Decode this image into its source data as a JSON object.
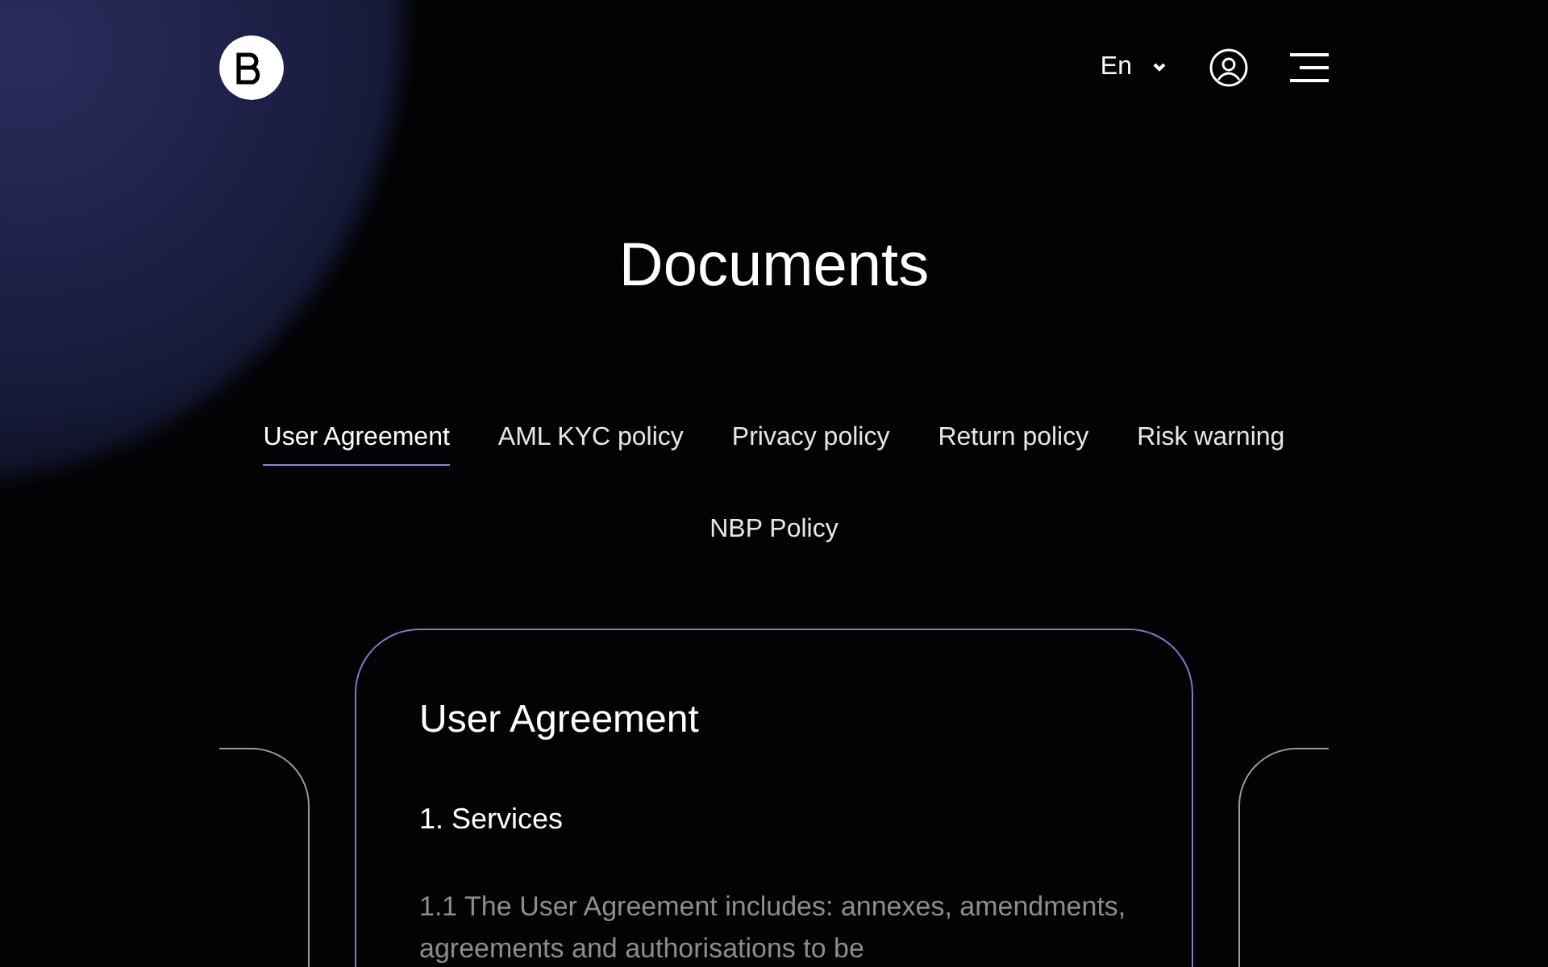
{
  "header": {
    "language": "En"
  },
  "title": "Documents",
  "tabs": [
    {
      "label": "User Agreement",
      "selected": true
    },
    {
      "label": "AML KYC policy",
      "selected": false
    },
    {
      "label": "Privacy policy",
      "selected": false
    },
    {
      "label": "Return policy",
      "selected": false
    },
    {
      "label": "Risk warning",
      "selected": false
    },
    {
      "label": "NBP Policy",
      "selected": false
    }
  ],
  "document": {
    "title": "User Agreement",
    "section": "1. Services",
    "paragraph": "1.1 The User Agreement includes: annexes, amendments, agreements and authorisations to be"
  }
}
